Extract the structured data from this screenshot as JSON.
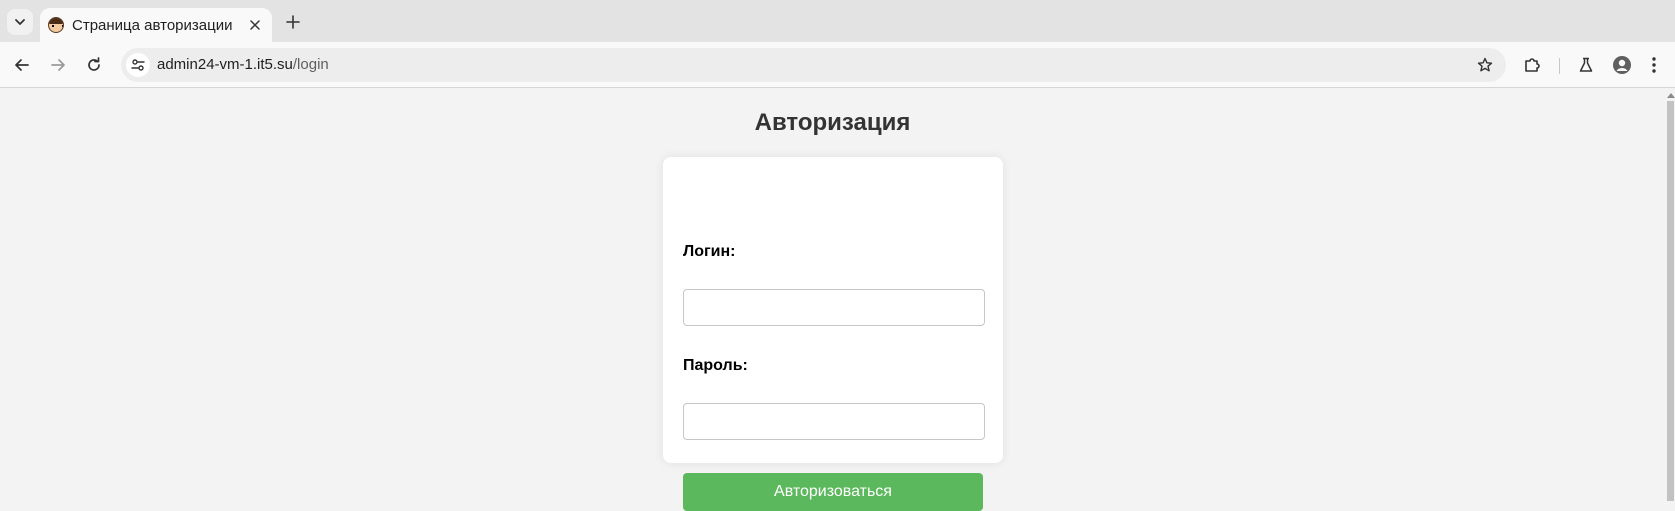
{
  "browser": {
    "tab": {
      "title": "Страница авторизации",
      "favicon": "cartoon-face-icon"
    },
    "address_bar": {
      "host": "admin24-vm-1.it5.su",
      "path": "/login"
    },
    "icons": {
      "tab_search": "chevron-down-icon",
      "close_tab": "close-icon",
      "new_tab": "plus-icon",
      "back": "arrow-left-icon",
      "forward": "arrow-right-icon",
      "reload": "reload-icon",
      "site_info": "tune-icon",
      "bookmark": "star-icon",
      "extensions": "puzzle-icon",
      "labs": "flask-icon",
      "profile": "avatar-icon",
      "menu": "kebab-menu-icon"
    }
  },
  "page": {
    "title": "Авторизация",
    "form": {
      "login_label": "Логин:",
      "login_value": "",
      "password_label": "Пароль:",
      "password_value": "",
      "submit_label": "Авторизоваться"
    }
  },
  "colors": {
    "submit_button": "#5cb85c",
    "page_background": "#f3f3f3"
  }
}
